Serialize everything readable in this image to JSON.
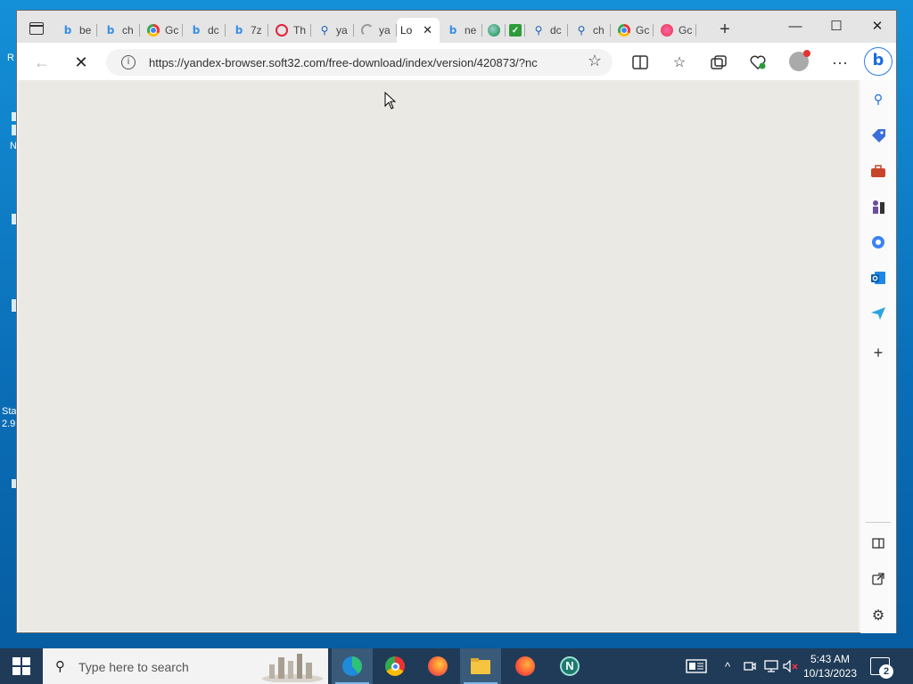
{
  "desktop": {
    "fragments": [
      "R",
      "N",
      "Sta",
      "2.9"
    ]
  },
  "browser": {
    "tabs": [
      {
        "label": "be",
        "icon": "bing-icon"
      },
      {
        "label": "ch",
        "icon": "bing-icon"
      },
      {
        "label": "Gc",
        "icon": "chrome-icon"
      },
      {
        "label": "dc",
        "icon": "bing-icon"
      },
      {
        "label": "7z",
        "icon": "bing-icon"
      },
      {
        "label": "Th",
        "icon": "opera-icon"
      },
      {
        "label": "ya",
        "icon": "search-icon"
      },
      {
        "label": "ya",
        "icon": "loading-spinner-icon"
      },
      {
        "label": "Lo",
        "icon": "none",
        "active": true
      },
      {
        "label": "ne",
        "icon": "bing-icon"
      },
      {
        "label": "",
        "icon": "globe-icon"
      },
      {
        "label": "",
        "icon": "checkmark-icon"
      },
      {
        "label": "dc",
        "icon": "search-icon"
      },
      {
        "label": "ch",
        "icon": "search-icon"
      },
      {
        "label": "Gc",
        "icon": "chrome-icon"
      },
      {
        "label": "Gc",
        "icon": "pink-icon"
      }
    ],
    "active_tab_close": "✕",
    "new_tab": "+",
    "window_controls": {
      "minimize": "—",
      "maximize": "☐",
      "close": "✕"
    },
    "url": "https://yandex-browser.soft32.com/free-download/index/version/420873/?nc",
    "page_loading": true,
    "sidebar_icons": [
      "search-icon",
      "tag-icon",
      "toolbox-icon",
      "chess-icon",
      "copilot-icon",
      "outlook-icon",
      "send-icon",
      "add-icon",
      "split-screen-icon",
      "external-link-icon",
      "settings-icon"
    ],
    "sidebar_add": "+"
  },
  "taskbar": {
    "search_placeholder": "Type here to search",
    "apps": [
      "edge-icon",
      "chrome-icon",
      "firefox-icon",
      "file-explorer-icon",
      "firefox-icon",
      "n-app-icon"
    ],
    "time": "5:43 AM",
    "date": "10/13/2023",
    "notification_count": "2"
  },
  "colors": {
    "taskbar": "#1f3b57",
    "content_bg": "#ebe9e3",
    "accent": "#2a7de1"
  }
}
